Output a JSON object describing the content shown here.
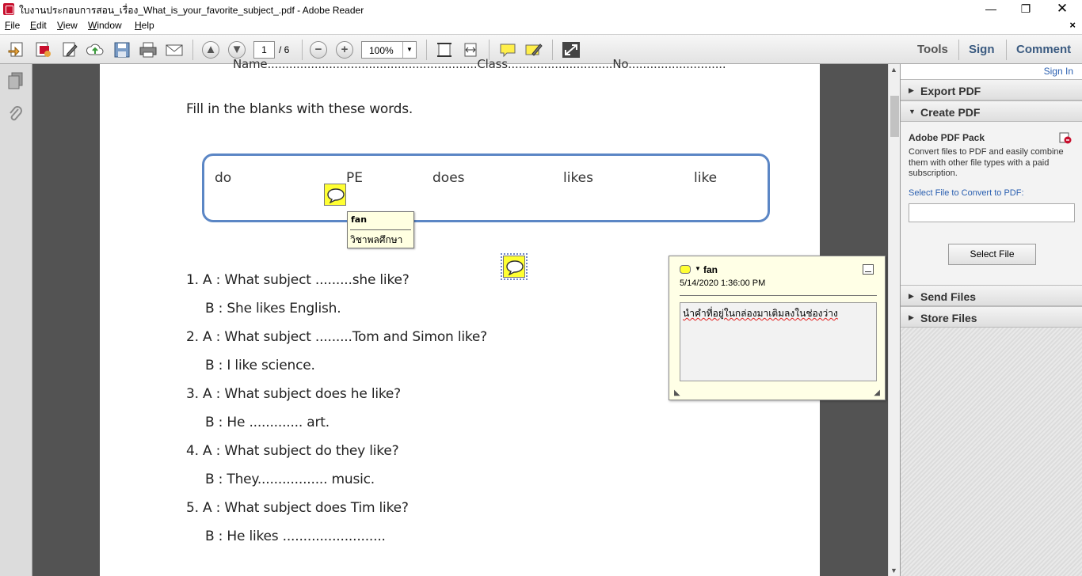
{
  "window": {
    "title": "ใบงานประกอบการสอน_เรื่อง_What_is_your_favorite_subject_.pdf - Adobe Reader",
    "minimize": "—",
    "maximize": "❐",
    "close": "✕"
  },
  "menu": {
    "items": [
      "File",
      "Edit",
      "View",
      "Window",
      "Help"
    ],
    "close_doc": "×"
  },
  "toolbar": {
    "page_current": "1",
    "page_total": "/ 6",
    "zoom": "100%",
    "zoom_out": "−",
    "zoom_in": "+",
    "prev_page": "▲",
    "next_page": "▼",
    "nav": {
      "tools": "Tools",
      "sign": "Sign",
      "comment": "Comment"
    }
  },
  "document": {
    "header_line": "Name..........................................................Class.............................No...........................",
    "instruction": "Fill in the blanks with these words.",
    "words": [
      "do",
      "PE",
      "does",
      "likes",
      "like"
    ],
    "questions": [
      {
        "a": "1. A : What subject .........she like?",
        "b": "B : She likes English."
      },
      {
        "a": "2. A : What subject .........Tom and Simon like?",
        "b": "B : I like  science."
      },
      {
        "a": "3. A : What subject does he like?",
        "b": "B : He ............. art."
      },
      {
        "a": "4. A : What subject do they like?",
        "b": "B : They................. music."
      },
      {
        "a": "5. A : What subject does Tim like?",
        "b": "B : He likes ........................."
      }
    ]
  },
  "tooltip": {
    "author": "fan",
    "text": "วิชาพลศึกษา"
  },
  "popup": {
    "author": "fan",
    "date": "5/14/2020 1:36:00 PM",
    "text": "นำคำที่อยู่ในกล่องมาเติมลงในช่องว่าง"
  },
  "right_panel": {
    "sign_in": "Sign In",
    "sections": {
      "export": "Export PDF",
      "create": "Create PDF",
      "send": "Send Files",
      "store": "Store Files"
    },
    "create_pdf": {
      "pack_title": "Adobe PDF Pack",
      "description": "Convert files to PDF and easily combine them with other file types with a paid subscription.",
      "select_label": "Select File to Convert to PDF:",
      "file_value": "",
      "select_button": "Select File"
    }
  },
  "colors": {
    "accent_blue": "#2a5fb0",
    "word_box_border": "#5b86c5",
    "note_yellow": "#ffff33",
    "doc_background": "#535353"
  }
}
